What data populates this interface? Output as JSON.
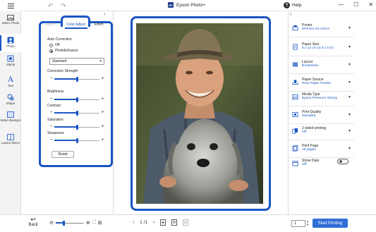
{
  "titlebar": {
    "app_title": "Epson Photo+",
    "logo_text": "EP",
    "help_label": "Help",
    "help_glyph": "?",
    "menu_icon": "hamburger-icon",
    "undo_glyph": "↶",
    "redo_glyph": "↷",
    "minimize_glyph": "—",
    "maximize_glyph": "☐",
    "close_glyph": "✕"
  },
  "left_tools": [
    {
      "id": "select-photo",
      "label": "Select Photo",
      "icon": "photo-icon"
    },
    {
      "id": "photo-edit",
      "label": "Photo",
      "icon": "person-icon",
      "active": true
    },
    {
      "id": "stamp",
      "label": "Stamp",
      "icon": "stamp-icon"
    },
    {
      "id": "text",
      "label": "Text",
      "icon": "text-icon"
    },
    {
      "id": "shape",
      "label": "Shape",
      "icon": "shape-icon"
    },
    {
      "id": "select-background",
      "label": "Select Backgro",
      "icon": "background-icon"
    },
    {
      "id": "layout-select",
      "label": "Layout Select",
      "icon": "layout-icon"
    }
  ],
  "edit_panel": {
    "tabs": {
      "filter": "Edit fil",
      "color_adjust": "Color Adjust",
      "effect": "Effect"
    },
    "auto_correction": "Auto Correction",
    "radio_off": "Off",
    "radio_photoenhance": "PhotoEnhance",
    "mode_select": "Standard",
    "sliders": {
      "correction_strength": {
        "label": "Correction Strength",
        "value": 0.5
      },
      "brightness": {
        "label": "Brightness",
        "value": 0.5
      },
      "contrast": {
        "label": "Contrast",
        "value": 0.5
      },
      "saturation": {
        "label": "Saturation",
        "value": 0.5
      },
      "sharpness": {
        "label": "Sharpness",
        "value": 0.5
      }
    },
    "minus": "−",
    "plus": "+",
    "reset_label": "Reset",
    "collapse_glyph": "‹"
  },
  "right_panel": {
    "collapse_glyph": "›",
    "settings": [
      {
        "id": "printer",
        "label": "Printer",
        "value": "EPSON XX-XXXX",
        "icon": "printer-icon"
      },
      {
        "id": "paper-size",
        "label": "Paper Size",
        "value": "9 x 13 cm (3.5 x 5 in)",
        "icon": "paper-icon"
      },
      {
        "id": "layout",
        "label": "Layout",
        "value": "Borderless",
        "icon": "layout-icon"
      },
      {
        "id": "paper-source",
        "label": "Paper Source",
        "value": "Rear Paper Feeder",
        "icon": "tray-icon"
      },
      {
        "id": "media-type",
        "label": "Media Type",
        "value": "Epson Premium Glossy",
        "icon": "media-icon"
      },
      {
        "id": "print-quality",
        "label": "Print Quality",
        "value": "Standard",
        "icon": "quality-icon"
      },
      {
        "id": "two-sided",
        "label": "2-sided printing",
        "value": "Off",
        "icon": "duplex-icon"
      },
      {
        "id": "print-page",
        "label": "Print Page",
        "value": "All pages",
        "icon": "pages-icon"
      },
      {
        "id": "show-date",
        "label": "Show Date",
        "value": "Off",
        "icon": "calendar-icon"
      }
    ],
    "chevron": "▾"
  },
  "bottom": {
    "back_label": "Back",
    "back_glyph": "↩",
    "zoom_out": "⊖",
    "zoom_in": "⊕",
    "fit_glyph": "⛶",
    "grid_glyph": "⊞",
    "page_prev": "‹",
    "page_next": "›",
    "page_indicator": "1 /1",
    "copies": "1",
    "start_printing": "Start Printing",
    "zoom_level": 0.3
  },
  "colors": {
    "accent": "#1a56c4",
    "print_button": "#2f6fd6"
  }
}
